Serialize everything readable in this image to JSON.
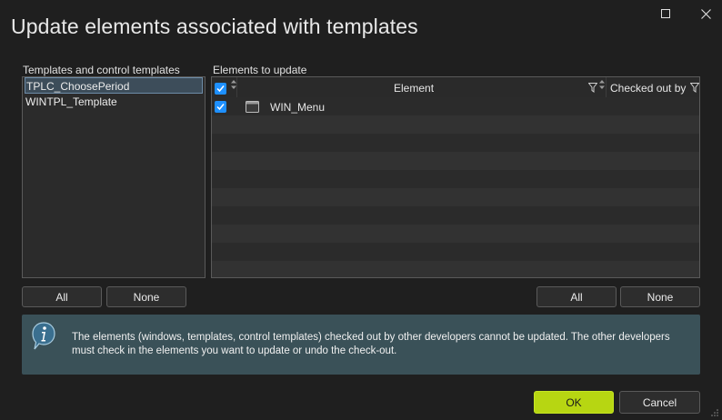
{
  "dialog": {
    "title": "Update elements associated with templates"
  },
  "templates": {
    "label": "Templates and control templates",
    "items": [
      {
        "name": "TPLC_ChoosePeriod",
        "selected": true
      },
      {
        "name": "WINTPL_Template",
        "selected": false
      }
    ],
    "all_label": "All",
    "none_label": "None"
  },
  "elements": {
    "label": "Elements to update",
    "columns": {
      "element": "Element",
      "checked_out_by": "Checked out by"
    },
    "rows": [
      {
        "checked": true,
        "name": "WIN_Menu",
        "checked_out_by": ""
      }
    ],
    "all_label": "All",
    "none_label": "None"
  },
  "info": {
    "message": "The elements (windows, templates, control templates) checked out by other developers cannot be updated. The other developers must check in the elements you want to update or undo the check-out."
  },
  "footer": {
    "ok_label": "OK",
    "cancel_label": "Cancel"
  },
  "colors": {
    "ok_button": "#b7d612",
    "checkbox": "#1e90ff",
    "info_background": "#3a5158"
  }
}
